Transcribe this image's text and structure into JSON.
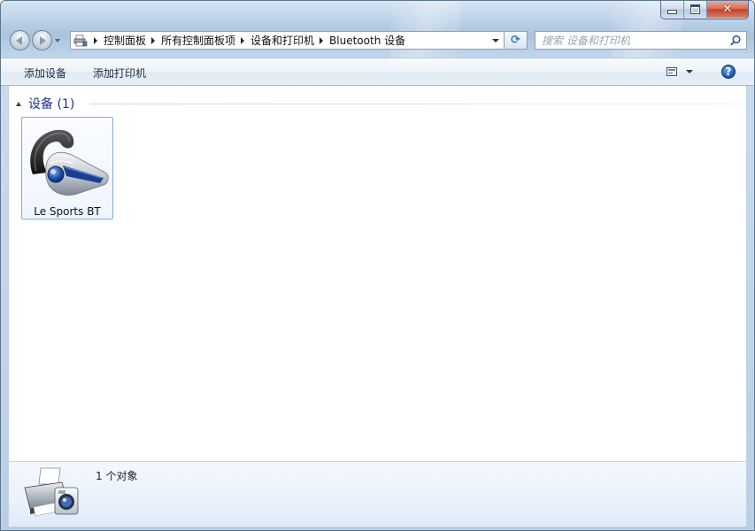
{
  "window": {
    "caption_buttons": {
      "minimize_icon": "minimize-icon",
      "maximize_icon": "maximize-icon",
      "close_glyph": "✕"
    }
  },
  "nav": {
    "back_icon": "back-arrow-icon",
    "forward_icon": "forward-arrow-icon",
    "breadcrumb": [
      "控制面板",
      "所有控制面板项",
      "设备和打印机",
      "Bluetooth 设备"
    ],
    "refresh_glyph": "⟳"
  },
  "search": {
    "placeholder": "搜索 设备和打印机"
  },
  "toolbar": {
    "add_device": "添加设备",
    "add_printer": "添加打印机",
    "help_glyph": "?"
  },
  "group": {
    "title": "设备 (1)"
  },
  "devices": [
    {
      "name": "Le Sports BT",
      "icon": "bluetooth-headset-icon"
    }
  ],
  "details": {
    "count_text": "1 个对象",
    "icon": "devices-printers-icon"
  },
  "colors": {
    "group_title": "#1e3287",
    "tile_border": "#84acdd",
    "accent_blue": "#1a56b3"
  }
}
